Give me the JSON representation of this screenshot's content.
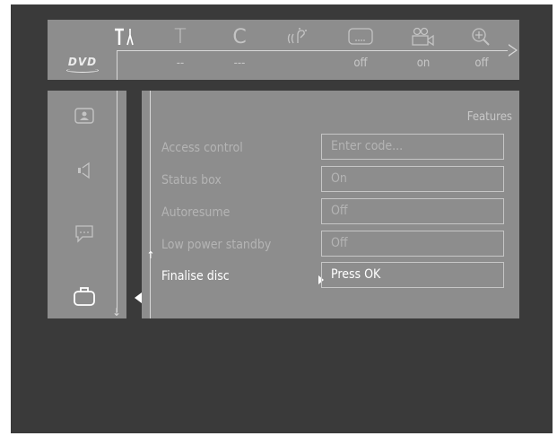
{
  "top_menu": {
    "logo_text": "DVD",
    "icons": [
      {
        "name": "tools-icon",
        "value": ""
      },
      {
        "name": "title-icon",
        "value": "--"
      },
      {
        "name": "chapter-icon",
        "value": "---"
      },
      {
        "name": "audio-icon",
        "value": ""
      },
      {
        "name": "subtitle-icon",
        "value": "off"
      },
      {
        "name": "angle-icon",
        "value": "on"
      },
      {
        "name": "zoom-icon",
        "value": "off"
      }
    ],
    "title_letter": "T",
    "chapter_letter": "C"
  },
  "side_menu": {
    "items": [
      "picture-icon",
      "sound-icon",
      "language-icon",
      "features-icon"
    ],
    "active": "features-icon"
  },
  "features": {
    "title": "Features",
    "rows": [
      {
        "label": "Access control",
        "value": "Enter code..."
      },
      {
        "label": "Status box",
        "value": "On"
      },
      {
        "label": "Autoresume",
        "value": "Off"
      },
      {
        "label": "Low power standby",
        "value": "Off"
      },
      {
        "label": "Finalise disc",
        "value": "Press OK"
      }
    ],
    "selected_index": 4
  },
  "colors": {
    "screen_bg": "#3a3a3a",
    "panel_bg": "#8d8d8d",
    "highlight": "#ffffff",
    "dim_text": "#b4b4b4"
  }
}
